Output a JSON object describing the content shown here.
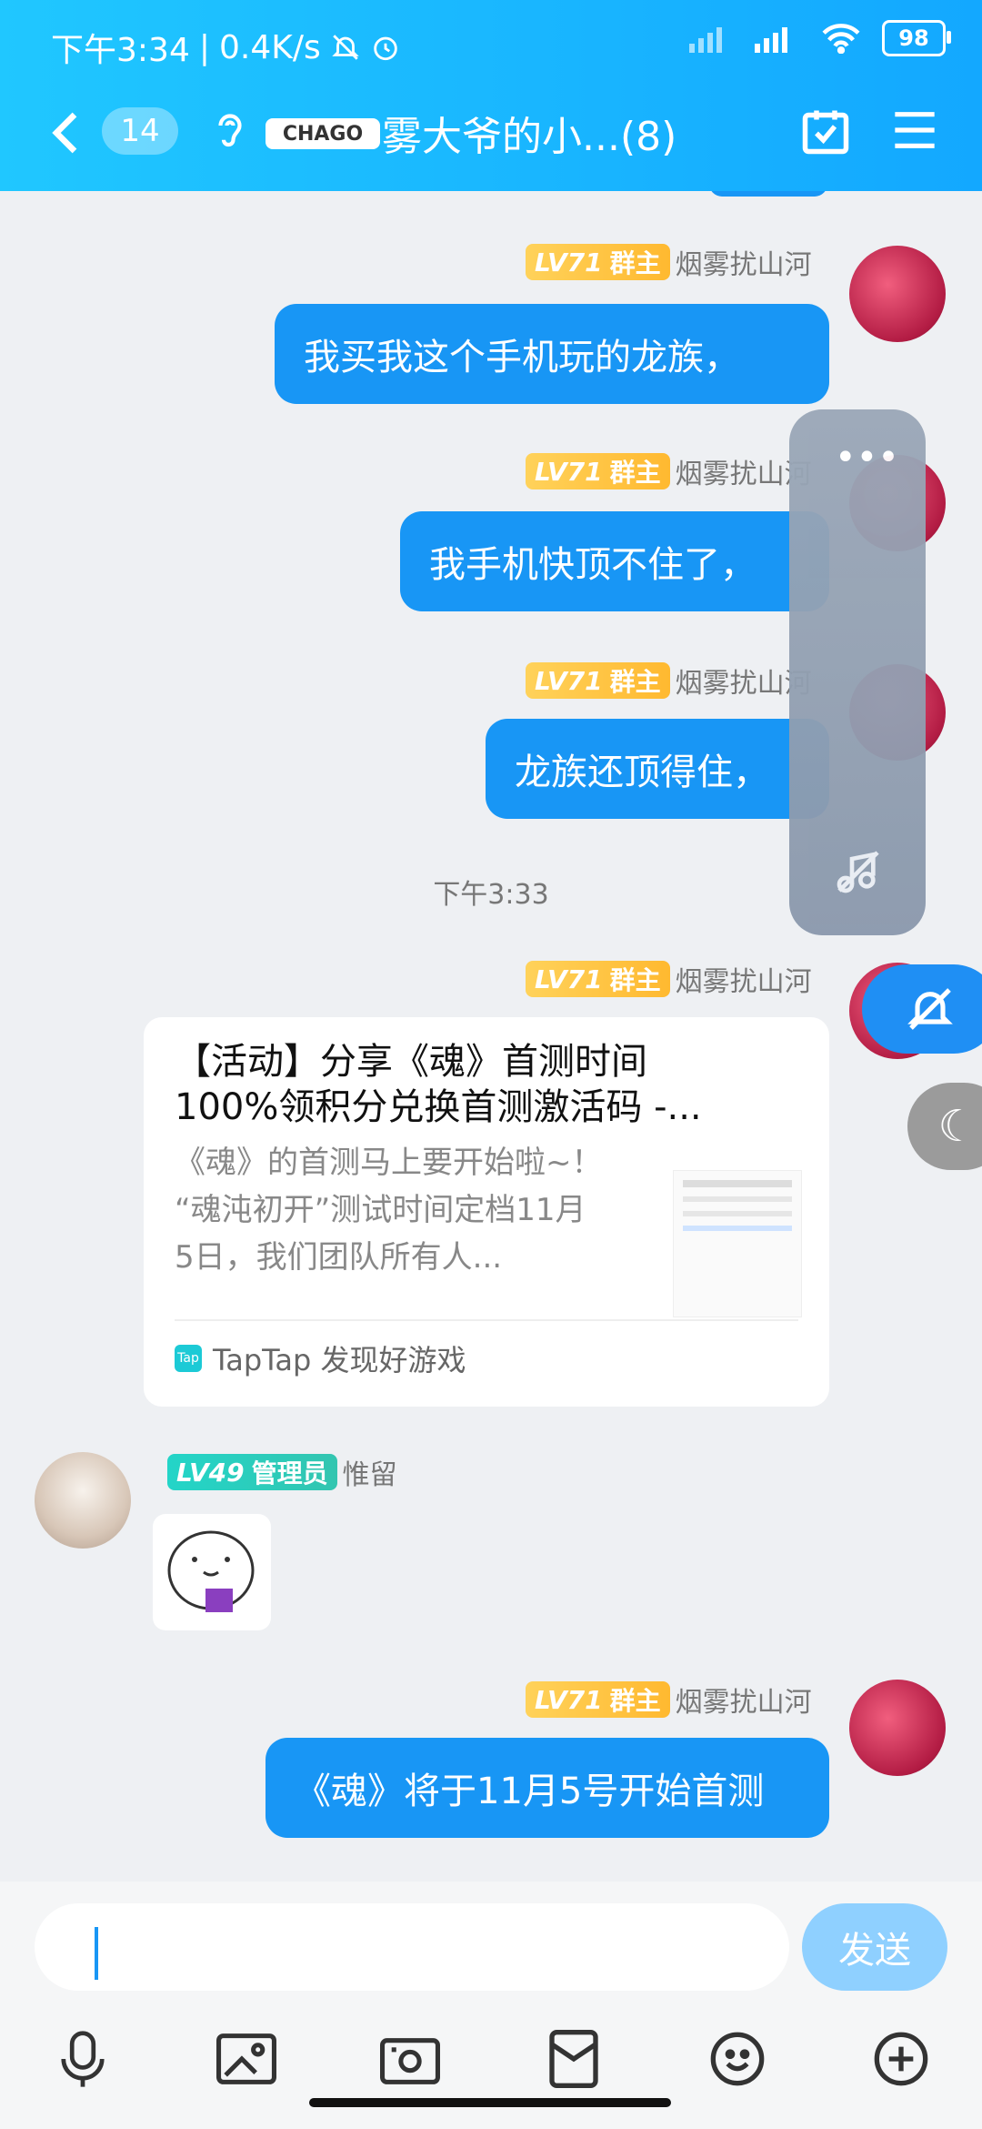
{
  "status": {
    "time": "下午3:34",
    "speed": "0.4K/s",
    "battery": "98"
  },
  "header": {
    "unread_count": "14",
    "logo_text": "CHAGO",
    "title": "雾大爷的小...(8)"
  },
  "messages": [
    {
      "level": "LV71",
      "role": "群主",
      "sender": "烟雾扰山河",
      "text": "我买我这个手机玩的龙族，"
    },
    {
      "level": "LV71",
      "role": "群主",
      "sender": "烟雾扰山河",
      "text": "我手机快顶不住了，"
    },
    {
      "level": "LV71",
      "role": "群主",
      "sender": "烟雾扰山河",
      "text": "龙族还顶得住，"
    },
    {
      "level": "LV71",
      "role": "群主",
      "sender": "烟雾扰山河"
    },
    {
      "level": "LV49",
      "role": "管理员",
      "sender": "惟留"
    },
    {
      "level": "LV71",
      "role": "群主",
      "sender": "烟雾扰山河",
      "text": "《魂》将于11月5号开始首测"
    }
  ],
  "timestamp": "下午3:33",
  "share_card": {
    "title_line1": "【活动】分享《魂》首测时间",
    "title_line2": "100%领积分兑换首测激活码 -...",
    "desc_line1": "《魂》的首测马上要开始啦~！",
    "desc_line2": "“魂沌初开”测试时间定档11月",
    "desc_line3": "5日，我们团队所有人...",
    "source_logo": "Tap",
    "source": "TapTap 发现好游戏"
  },
  "input": {
    "send_label": "发送"
  },
  "icons": {
    "voice": "microphone-icon",
    "image": "image-icon",
    "camera": "camera-icon",
    "red_packet": "red-packet-icon",
    "emoji": "emoji-icon",
    "plus": "plus-icon"
  }
}
